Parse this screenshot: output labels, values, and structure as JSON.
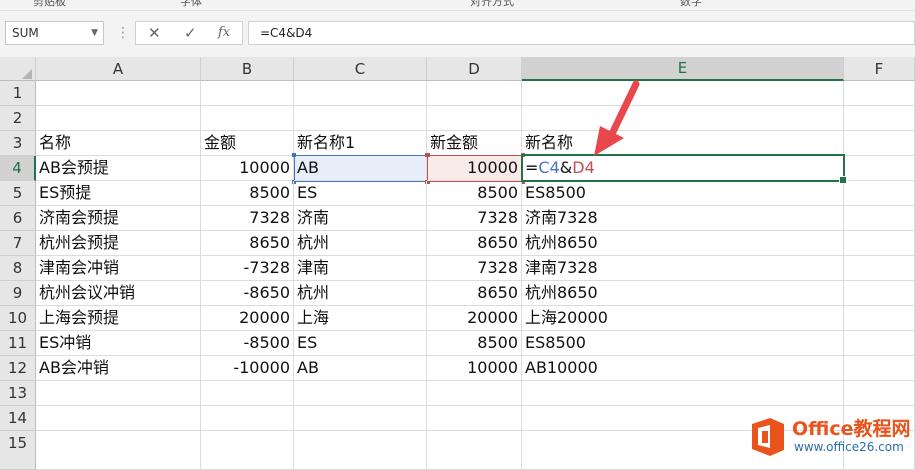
{
  "ribbon_fragments": [
    "剪贴板",
    "字体",
    "对齐方式",
    "数字"
  ],
  "formula_bar": {
    "name_box": "SUM",
    "cancel_glyph": "✕",
    "enter_glyph": "✓",
    "fx_glyph": "fx",
    "formula": "=C4&D4"
  },
  "columns": [
    "A",
    "B",
    "C",
    "D",
    "E",
    "F"
  ],
  "rows": [
    "1",
    "2",
    "3",
    "4",
    "5",
    "6",
    "7",
    "8",
    "9",
    "10",
    "11",
    "12",
    "13",
    "14",
    "15"
  ],
  "cells": {
    "r3": {
      "A": "名称",
      "B": "金额",
      "C": "新名称1",
      "D": "新金额",
      "E": "新名称"
    },
    "r4": {
      "A": "AB会预提",
      "B": "10000",
      "C": "AB",
      "D": "10000",
      "E_eq": "=",
      "E_c": "C4",
      "E_amp": "&",
      "E_d": "D4"
    },
    "r5": {
      "A": "ES预提",
      "B": "8500",
      "C": "ES",
      "D": "8500",
      "E": "ES8500"
    },
    "r6": {
      "A": "济南会预提",
      "B": "7328",
      "C": "济南",
      "D": "7328",
      "E": "济南7328"
    },
    "r7": {
      "A": "杭州会预提",
      "B": "8650",
      "C": "杭州",
      "D": "8650",
      "E": "杭州8650"
    },
    "r8": {
      "A": "津南会冲销",
      "B": "-7328",
      "C": "津南",
      "D": "7328",
      "E": "津南7328"
    },
    "r9": {
      "A": "杭州会议冲销",
      "B": "-8650",
      "C": "杭州",
      "D": "8650",
      "E": "杭州8650"
    },
    "r10": {
      "A": "上海会预提",
      "B": "20000",
      "C": "上海",
      "D": "20000",
      "E": "上海20000"
    },
    "r11": {
      "A": "ES冲销",
      "B": "-8500",
      "C": "ES",
      "D": "8500",
      "E": "ES8500"
    },
    "r12": {
      "A": "AB会冲销",
      "B": "-10000",
      "C": "AB",
      "D": "10000",
      "E": "AB10000"
    }
  },
  "watermark": {
    "brand": "Office教程网",
    "site": "www.office26.com"
  },
  "colors": {
    "accent": "#217346",
    "ref_c": "#4472c4",
    "ref_d": "#c0504d",
    "arrow": "#e8474b",
    "logo_orange": "#e8541c"
  }
}
